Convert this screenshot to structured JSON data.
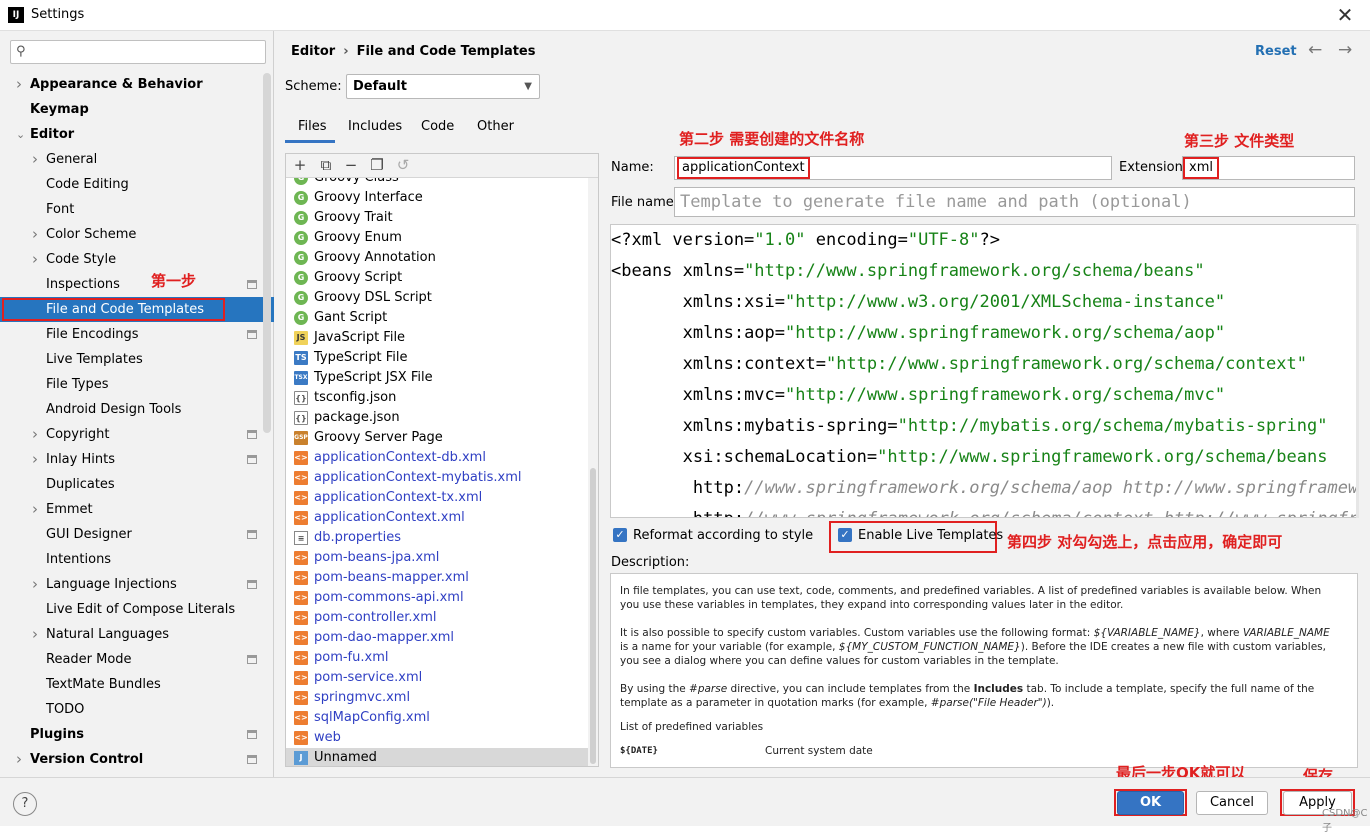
{
  "window": {
    "title": "Settings",
    "app_icon": "IJ"
  },
  "search": {
    "placeholder": ""
  },
  "sidebar": {
    "items": [
      {
        "label": "Appearance & Behavior",
        "level": 0,
        "chevron": true,
        "bold": true
      },
      {
        "label": "Keymap",
        "level": 0,
        "chevron": false,
        "bold": true
      },
      {
        "label": "Editor",
        "level": 0,
        "chevron": "open",
        "bold": true
      },
      {
        "label": "General",
        "level": 1,
        "chevron": true
      },
      {
        "label": "Code Editing",
        "level": 1
      },
      {
        "label": "Font",
        "level": 1
      },
      {
        "label": "Color Scheme",
        "level": 1,
        "chevron": true
      },
      {
        "label": "Code Style",
        "level": 1,
        "chevron": true
      },
      {
        "label": "Inspections",
        "level": 1,
        "proj": true
      },
      {
        "label": "File and Code Templates",
        "level": 1,
        "selected": true
      },
      {
        "label": "File Encodings",
        "level": 1,
        "proj": true
      },
      {
        "label": "Live Templates",
        "level": 1
      },
      {
        "label": "File Types",
        "level": 1
      },
      {
        "label": "Android Design Tools",
        "level": 1
      },
      {
        "label": "Copyright",
        "level": 1,
        "chevron": true,
        "proj": true
      },
      {
        "label": "Inlay Hints",
        "level": 1,
        "chevron": true,
        "proj": true
      },
      {
        "label": "Duplicates",
        "level": 1
      },
      {
        "label": "Emmet",
        "level": 1,
        "chevron": true
      },
      {
        "label": "GUI Designer",
        "level": 1,
        "proj": true
      },
      {
        "label": "Intentions",
        "level": 1
      },
      {
        "label": "Language Injections",
        "level": 1,
        "chevron": true,
        "proj": true
      },
      {
        "label": "Live Edit of Compose Literals",
        "level": 1
      },
      {
        "label": "Natural Languages",
        "level": 1,
        "chevron": true
      },
      {
        "label": "Reader Mode",
        "level": 1,
        "proj": true
      },
      {
        "label": "TextMate Bundles",
        "level": 1
      },
      {
        "label": "TODO",
        "level": 1
      },
      {
        "label": "Plugins",
        "level": 0,
        "bold": true,
        "proj": true
      },
      {
        "label": "Version Control",
        "level": 0,
        "chevron": true,
        "bold": true,
        "proj": true
      }
    ]
  },
  "header": {
    "breadcrumb_root": "Editor",
    "breadcrumb_sep": "›",
    "breadcrumb_leaf": "File and Code Templates",
    "reset": "Reset",
    "back": "←",
    "forward": "→"
  },
  "scheme": {
    "label": "Scheme:",
    "value": "Default"
  },
  "tabs": [
    "Files",
    "Includes",
    "Code",
    "Other"
  ],
  "toolbar": {
    "add": "+",
    "copy": "⧉",
    "remove": "−",
    "duplicate": "❐",
    "revert": "↺"
  },
  "files": [
    {
      "name": "Groovy Class",
      "icon": "groovy",
      "tag": "G"
    },
    {
      "name": "Groovy Interface",
      "icon": "groovy",
      "tag": "G"
    },
    {
      "name": "Groovy Trait",
      "icon": "groovy",
      "tag": "G"
    },
    {
      "name": "Groovy Enum",
      "icon": "groovy",
      "tag": "G"
    },
    {
      "name": "Groovy Annotation",
      "icon": "groovy",
      "tag": "G"
    },
    {
      "name": "Groovy Script",
      "icon": "groovy",
      "tag": "G"
    },
    {
      "name": "Groovy DSL Script",
      "icon": "groovy",
      "tag": "G"
    },
    {
      "name": "Gant Script",
      "icon": "groovy",
      "tag": "G"
    },
    {
      "name": "JavaScript File",
      "icon": "js",
      "tag": "JS"
    },
    {
      "name": "TypeScript File",
      "icon": "ts",
      "tag": "TS"
    },
    {
      "name": "TypeScript JSX File",
      "icon": "ts",
      "tag": "TSX"
    },
    {
      "name": "tsconfig.json",
      "icon": "json",
      "tag": "{}"
    },
    {
      "name": "package.json",
      "icon": "json",
      "tag": "{}"
    },
    {
      "name": "Groovy Server Page",
      "icon": "gsp",
      "tag": "GSP"
    },
    {
      "name": "applicationContext-db.xml",
      "icon": "xml",
      "tag": "<>",
      "custom": true
    },
    {
      "name": "applicationContext-mybatis.xml",
      "icon": "xml",
      "tag": "<>",
      "custom": true
    },
    {
      "name": "applicationContext-tx.xml",
      "icon": "xml",
      "tag": "<>",
      "custom": true
    },
    {
      "name": "applicationContext.xml",
      "icon": "xml",
      "tag": "<>",
      "custom": true
    },
    {
      "name": "db.properties",
      "icon": "props",
      "tag": "≡",
      "custom": true
    },
    {
      "name": "pom-beans-jpa.xml",
      "icon": "xml",
      "tag": "<>",
      "custom": true
    },
    {
      "name": "pom-beans-mapper.xml",
      "icon": "xml",
      "tag": "<>",
      "custom": true
    },
    {
      "name": "pom-commons-api.xml",
      "icon": "xml",
      "tag": "<>",
      "custom": true
    },
    {
      "name": "pom-controller.xml",
      "icon": "xml",
      "tag": "<>",
      "custom": true
    },
    {
      "name": "pom-dao-mapper.xml",
      "icon": "xml",
      "tag": "<>",
      "custom": true
    },
    {
      "name": "pom-fu.xml",
      "icon": "xml",
      "tag": "<>",
      "custom": true
    },
    {
      "name": "pom-service.xml",
      "icon": "xml",
      "tag": "<>",
      "custom": true
    },
    {
      "name": "springmvc.xml",
      "icon": "xml",
      "tag": "<>",
      "custom": true
    },
    {
      "name": "sqlMapConfig.xml",
      "icon": "xml",
      "tag": "<>",
      "custom": true
    },
    {
      "name": "web",
      "icon": "xml",
      "tag": "<>",
      "custom": true
    },
    {
      "name": "Unnamed",
      "icon": "java",
      "tag": "J",
      "selected": true
    }
  ],
  "form": {
    "name_label": "Name:",
    "name_value": "applicationContext",
    "ext_label": "Extension:",
    "ext_value": "xml",
    "filename_label": "File name:",
    "filename_placeholder": "Template to generate file name and path (optional)"
  },
  "code": [
    {
      "indent": "",
      "parts": [
        {
          "t": "<?xml version="
        },
        {
          "t": "\"1.0\"",
          "k": "s"
        },
        {
          "t": " encoding="
        },
        {
          "t": "\"UTF-8\"",
          "k": "s"
        },
        {
          "t": "?>"
        }
      ]
    },
    {
      "indent": "",
      "parts": [
        {
          "t": "<beans xmlns="
        },
        {
          "t": "\"http://www.springframework.org/schema/beans\"",
          "k": "s"
        }
      ]
    },
    {
      "indent": "       ",
      "parts": [
        {
          "t": "xmlns:xsi="
        },
        {
          "t": "\"http://www.w3.org/2001/XMLSchema-instance\"",
          "k": "s"
        }
      ]
    },
    {
      "indent": "       ",
      "parts": [
        {
          "t": "xmlns:aop="
        },
        {
          "t": "\"http://www.springframework.org/schema/aop\"",
          "k": "s"
        }
      ]
    },
    {
      "indent": "       ",
      "parts": [
        {
          "t": "xmlns:context="
        },
        {
          "t": "\"http://www.springframework.org/schema/context\"",
          "k": "s"
        }
      ]
    },
    {
      "indent": "       ",
      "parts": [
        {
          "t": "xmlns:mvc="
        },
        {
          "t": "\"http://www.springframework.org/schema/mvc\"",
          "k": "s"
        }
      ]
    },
    {
      "indent": "       ",
      "parts": [
        {
          "t": "xmlns:mybatis-spring="
        },
        {
          "t": "\"http://mybatis.org/schema/mybatis-spring\"",
          "k": "s"
        }
      ]
    },
    {
      "indent": "       ",
      "parts": [
        {
          "t": "xsi:schemaLocation="
        },
        {
          "t": "\"http://www.springframework.org/schema/beans",
          "k": "s"
        }
      ]
    },
    {
      "indent": "        ",
      "parts": [
        {
          "t": "http:"
        },
        {
          "t": "//www.springframework.org/schema/aop http://www.springframework.org/schema/aop",
          "k": "c"
        }
      ]
    },
    {
      "indent": "        ",
      "parts": [
        {
          "t": "http:"
        },
        {
          "t": "//www.springframework.org/schema/context http://www.springframework.org/schema/context",
          "k": "c"
        }
      ]
    }
  ],
  "options": {
    "reformat_label": "Reformat according to style",
    "reformat_checked": true,
    "live_label": "Enable Live Templates",
    "live_checked": true
  },
  "description": {
    "label": "Description:",
    "p1": "In file templates, you can use text, code, comments, and predefined variables. A list of predefined variables is available below. When you use these variables in templates, they expand into corresponding values later in the editor.",
    "p2a": "It is also possible to specify custom variables. Custom variables use the following format: ",
    "p2v1": "${VARIABLE_NAME}",
    "p2b": ", where ",
    "p2v2": "VARIABLE_NAME",
    "p2c": " is a name for your variable (for example, ",
    "p2v3": "${MY_CUSTOM_FUNCTION_NAME}",
    "p2d": "). Before the IDE creates a new file with custom variables, you see a dialog where you can define values for custom variables in the template.",
    "p3a": "By using the ",
    "p3v1": "#parse",
    "p3b": " directive, you can include templates from the ",
    "p3v2": "Includes",
    "p3c": " tab. To include a template, specify the full name of the template as a parameter in quotation marks (for example, ",
    "p3v3": "#parse(\"File Header\")",
    "p3d": ").",
    "p4": "List of predefined variables",
    "var_name": "${DATE}",
    "var_desc": "Current system date"
  },
  "annotations": {
    "step1": "第一步",
    "step2": "第二步 需要创建的文件名称",
    "step3": "第三步 文件类型",
    "step4": "第四步 对勾勾选上，点击应用，确定即可",
    "last_step": "最后一步OK就可以",
    "save": "保存"
  },
  "buttons": {
    "help": "?",
    "ok": "OK",
    "cancel": "Cancel",
    "apply": "Apply"
  },
  "watermark": "CSDN@C子",
  "colors": {
    "accent": "#3574c3",
    "selected": "#2675bf",
    "annotation": "#e02020",
    "string": "#178317",
    "custom_template": "#2f3fc3"
  }
}
